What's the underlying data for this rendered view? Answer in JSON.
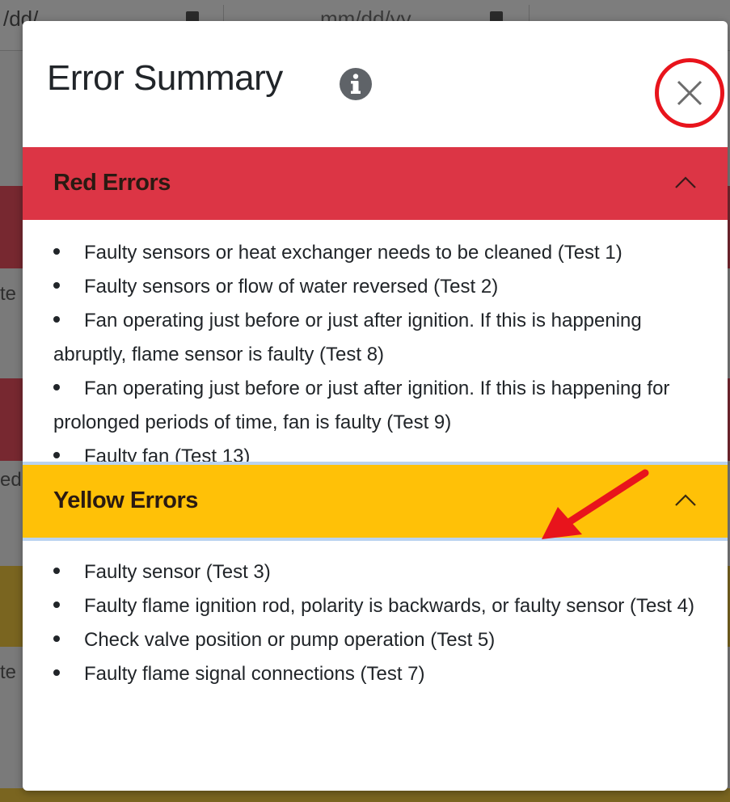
{
  "background": {
    "date_field_1": "/dd/",
    "date_field_2": "mm/dd/yy",
    "side_letters": [
      "te",
      "ed",
      "te"
    ]
  },
  "modal": {
    "title": "Error Summary",
    "info_icon": "info-circle-icon",
    "close_icon": "close-icon"
  },
  "red_section": {
    "title": "Red Errors",
    "color": "#dc3545",
    "items": [
      "Faulty sensors or heat exchanger needs to be cleaned (Test 1)",
      "Faulty sensors or flow of water reversed (Test 2)",
      "Fan operating just before or just after ignition. If this is happening abruptly, flame sensor is faulty (Test 8)",
      "Fan operating just before or just after ignition. If this is happening for prolonged periods of time, fan is faulty (Test 9)",
      "Faulty fan (Test 13)"
    ]
  },
  "yellow_section": {
    "title": "Yellow Errors",
    "color": "#ffc107",
    "items": [
      "Faulty sensor (Test 3)",
      "Faulty flame ignition rod, polarity is backwards, or faulty sensor (Test 4)",
      "Check valve position or pump operation (Test 5)",
      "Faulty flame signal connections (Test 7)"
    ]
  },
  "annotations": {
    "highlight_color": "#e8141c"
  }
}
